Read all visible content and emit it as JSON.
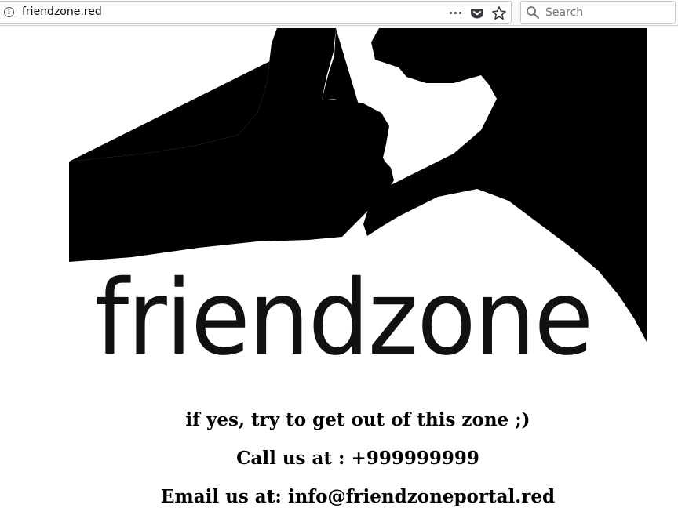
{
  "browser": {
    "url": "friendzone.red",
    "search_placeholder": "Search",
    "icons": [
      "info-icon",
      "page-actions-icon",
      "pocket-icon",
      "bookmark-star-icon",
      "search-icon"
    ]
  },
  "page": {
    "logo_text": "friendzone",
    "lines": [
      "if yes, try to get out of this zone ;)",
      "Call us at : +999999999",
      "Email us at: info@friendzoneportal.red"
    ]
  }
}
